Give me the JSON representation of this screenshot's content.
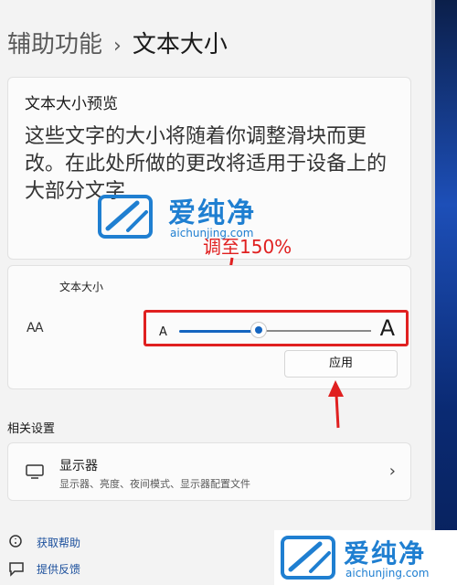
{
  "breadcrumb": {
    "parent": "辅助功能",
    "separator": "›",
    "current": "文本大小"
  },
  "preview": {
    "title": "文本大小预览",
    "body": "这些文字的大小将随着你调整滑块而更改。在此处所做的更改将适用于设备上的大部分文字"
  },
  "text_size": {
    "label": "文本大小",
    "icon_text": "AA",
    "slider": {
      "small_label": "A",
      "large_label": "A",
      "value_percent": 150,
      "fill_fraction": 0.43
    },
    "apply_label": "应用"
  },
  "annotation": {
    "text": "调至150%",
    "color": "#e02020"
  },
  "related": {
    "heading": "相关设置",
    "display": {
      "title": "显示器",
      "subtitle": "显示器、亮度、夜间模式、显示器配置文件",
      "icon": "monitor-icon"
    }
  },
  "links": {
    "help": "获取帮助",
    "feedback": "提供反馈"
  },
  "watermark": {
    "name": "爱纯净",
    "url": "aichunjing.com",
    "color": "#1f7fd1"
  },
  "colors": {
    "accent": "#1565c0",
    "highlight": "#e02020",
    "background": "#f3f3f3"
  }
}
